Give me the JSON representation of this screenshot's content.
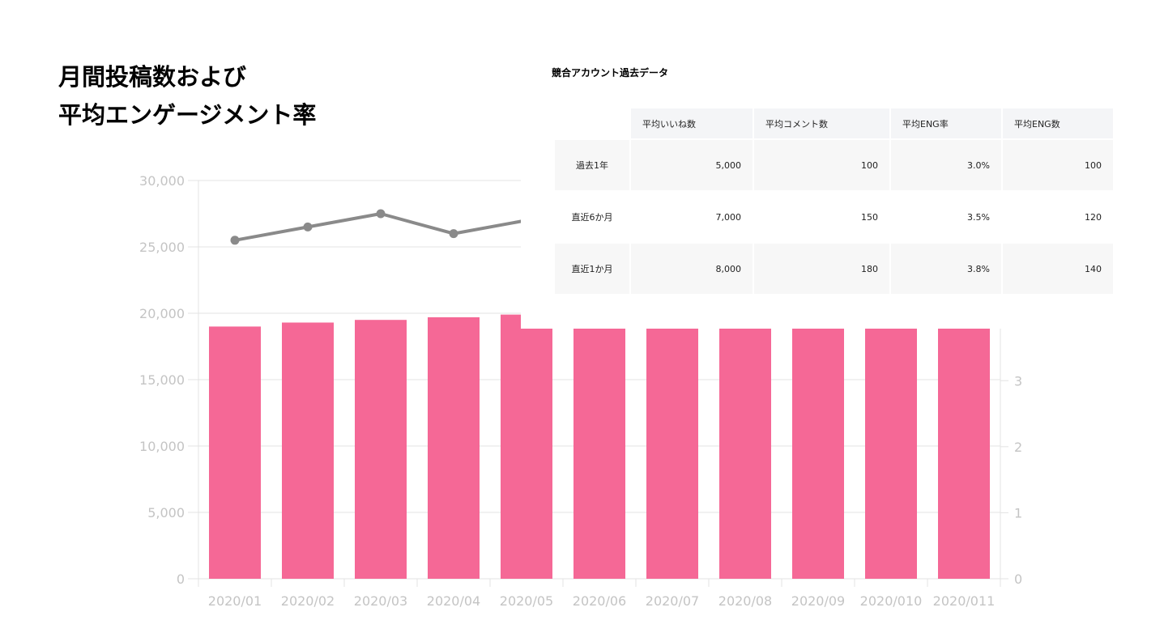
{
  "title": {
    "line1": "月間投稿数および",
    "line2": "平均エンゲージメント率"
  },
  "colors": {
    "bar": "#f56896",
    "line": "#8a8a8a",
    "grid": "#e3e3e3",
    "tick": "#c4c4c4"
  },
  "chart_data": {
    "type": "bar",
    "categories": [
      "2020/01",
      "2020/02",
      "2020/03",
      "2020/04",
      "2020/05",
      "2020/06",
      "2020/07",
      "2020/08",
      "2020/09",
      "2020/010",
      "2020/011"
    ],
    "series": [
      {
        "type": "bar",
        "axis": "left",
        "values": [
          19000,
          19300,
          19500,
          19700,
          19900,
          19000,
          19000,
          19000,
          19000,
          19000,
          19000
        ]
      },
      {
        "type": "line",
        "axis": "left",
        "values": [
          25500,
          26500,
          27500,
          26000,
          27000
        ]
      }
    ],
    "y_left": {
      "min": 0,
      "max": 30000,
      "ticks": [
        "0",
        "5,000",
        "10,000",
        "15,000",
        "20,000",
        "25,000",
        "30,000"
      ]
    },
    "y_right": {
      "min": 0,
      "max": 3.8,
      "ticks": [
        "0",
        "1",
        "2",
        "3"
      ]
    },
    "grid": true,
    "legend": "none"
  },
  "table": {
    "title": "競合アカウント過去データ",
    "headers": [
      "",
      "平均いいね数",
      "平均コメント数",
      "平均ENG率",
      "平均ENG数"
    ],
    "rows": [
      [
        "過去1年",
        "5,000",
        "100",
        "3.0%",
        "100"
      ],
      [
        "直近6か月",
        "7,000",
        "150",
        "3.5%",
        "120"
      ],
      [
        "直近1か月",
        "8,000",
        "180",
        "3.8%",
        "140"
      ]
    ]
  }
}
